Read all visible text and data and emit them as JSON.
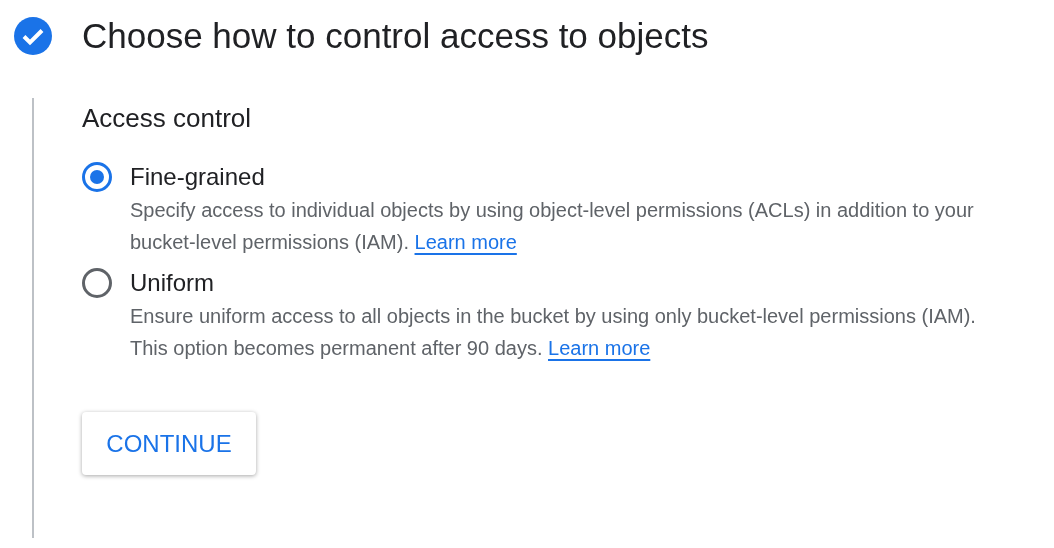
{
  "step": {
    "title": "Choose how to control access to objects",
    "completed": true
  },
  "section_title": "Access control",
  "options": [
    {
      "label": "Fine-grained",
      "description": "Specify access to individual objects by using object-level permissions (ACLs) in addition to your bucket-level permissions (IAM).",
      "link": "Learn more",
      "selected": true
    },
    {
      "label": "Uniform",
      "description": "Ensure uniform access to all objects in the bucket by using only bucket-level permissions (IAM). This option becomes permanent after 90 days.",
      "link": "Learn more",
      "selected": false
    }
  ],
  "button": "CONTINUE"
}
